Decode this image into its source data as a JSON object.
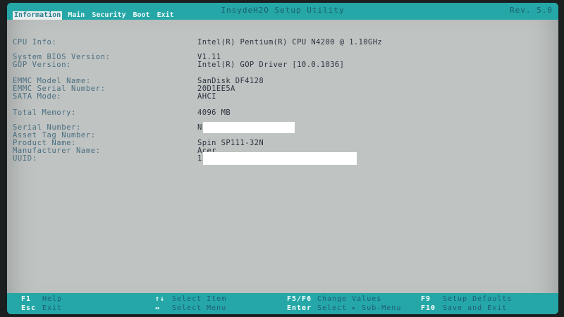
{
  "header": {
    "title": "InsydeH2O Setup Utility",
    "rev": "Rev. 5.0",
    "tabs": [
      "Information",
      "Main",
      "Security",
      "Boot",
      "Exit"
    ],
    "active_tab": "Information"
  },
  "info": {
    "rows": [
      {
        "label": "CPU Info:",
        "value": "Intel(R) Pentium(R) CPU N4200 @ 1.10GHz"
      },
      {
        "label": "System BIOS Version:",
        "value": "V1.11"
      },
      {
        "label": "GOP Version:",
        "value": "Intel(R) GOP Driver [10.0.1036]"
      },
      {
        "label": "EMMC Model Name:",
        "value": "SanDisk DF4128"
      },
      {
        "label": "EMMC Serial Number:",
        "value": "20D1EE5A"
      },
      {
        "label": "SATA Mode:",
        "value": "AHCI"
      },
      {
        "label": "Total Memory:",
        "value": "4096 MB"
      },
      {
        "label": "Serial Number:",
        "value": "N"
      },
      {
        "label": "Asset Tag Number:",
        "value": ""
      },
      {
        "label": "Product Name:",
        "value": "Spin SP111-32N"
      },
      {
        "label": "Manufacturer Name:",
        "value": "Acer"
      },
      {
        "label": "UUID:",
        "value": "1"
      }
    ]
  },
  "footer": {
    "items": [
      {
        "key": "F1",
        "desc": "Help"
      },
      {
        "key": "Esc",
        "desc": "Exit"
      },
      {
        "key": "↑↓",
        "desc": "Select Item"
      },
      {
        "key": "↔",
        "desc": "Select Menu"
      },
      {
        "key": "F5/F6",
        "desc": "Change Values"
      },
      {
        "key": "Enter",
        "desc": "Select ▸ Sub-Menu"
      },
      {
        "key": "F9",
        "desc": "Setup Defaults"
      },
      {
        "key": "F10",
        "desc": "Save and Exit"
      }
    ]
  }
}
